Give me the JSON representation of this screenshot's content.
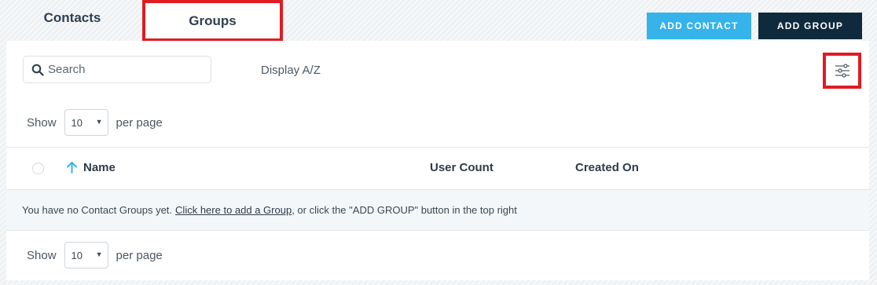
{
  "tabs": [
    {
      "label": "Contacts",
      "active": false
    },
    {
      "label": "Groups",
      "active": true
    }
  ],
  "actions": {
    "add_contact": "ADD CONTACT",
    "add_group": "ADD GROUP"
  },
  "toolbar": {
    "search_placeholder": "Search",
    "display_sort": "Display A/Z",
    "filter_icon": "sliders-icon"
  },
  "pagination": {
    "show_label": "Show",
    "per_page_value": "10",
    "per_page_label": "per page"
  },
  "table": {
    "columns": [
      "Name",
      "User Count",
      "Created On"
    ],
    "sort_column": "Name",
    "sort_direction": "ascending"
  },
  "empty_state": {
    "prefix": "You have no Contact Groups yet.",
    "link": "Click here to add a Group",
    "suffix": ", or click the \"ADD GROUP\" button in the top right"
  },
  "colors": {
    "highlight": "#e01b22",
    "add_contact_bg": "#35b3ea",
    "add_group_bg": "#0f2a3d",
    "sort_arrow": "#35b3ea"
  }
}
